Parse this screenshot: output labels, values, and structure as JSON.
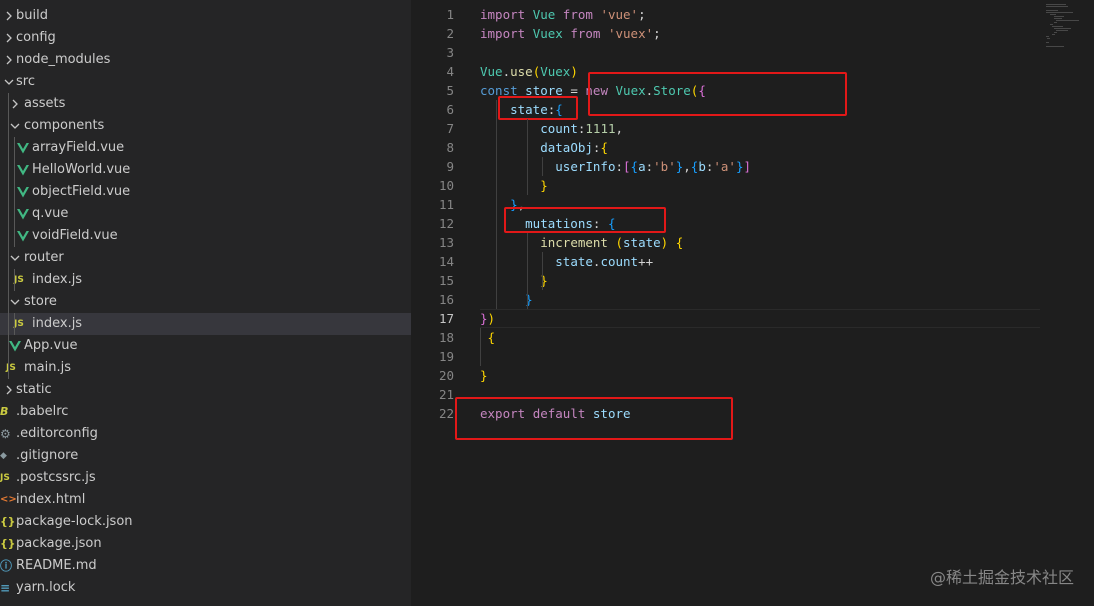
{
  "explorer": {
    "items": [
      {
        "label": "build",
        "type": "folder",
        "expanded": false
      },
      {
        "label": "config",
        "type": "folder",
        "expanded": false
      },
      {
        "label": "node_modules",
        "type": "folder",
        "expanded": false
      },
      {
        "label": "src",
        "type": "folder",
        "expanded": true
      },
      {
        "label": "assets",
        "type": "folder",
        "expanded": false
      },
      {
        "label": "components",
        "type": "folder",
        "expanded": true
      },
      {
        "label": "arrayField.vue",
        "type": "vue"
      },
      {
        "label": "HelloWorld.vue",
        "type": "vue"
      },
      {
        "label": "objectField.vue",
        "type": "vue"
      },
      {
        "label": "q.vue",
        "type": "vue"
      },
      {
        "label": "voidField.vue",
        "type": "vue"
      },
      {
        "label": "router",
        "type": "folder",
        "expanded": true
      },
      {
        "label": "index.js",
        "type": "js"
      },
      {
        "label": "store",
        "type": "folder",
        "expanded": true
      },
      {
        "label": "index.js",
        "type": "js",
        "selected": true
      },
      {
        "label": "App.vue",
        "type": "vue"
      },
      {
        "label": "main.js",
        "type": "js"
      },
      {
        "label": "static",
        "type": "folder",
        "expanded": false
      },
      {
        "label": ".babelrc",
        "type": "babel"
      },
      {
        "label": ".editorconfig",
        "type": "gear"
      },
      {
        "label": ".gitignore",
        "type": "git"
      },
      {
        "label": ".postcssrc.js",
        "type": "js"
      },
      {
        "label": "index.html",
        "type": "html"
      },
      {
        "label": "package-lock.json",
        "type": "json"
      },
      {
        "label": "package.json",
        "type": "json"
      },
      {
        "label": "README.md",
        "type": "info"
      },
      {
        "label": "yarn.lock",
        "type": "yarn"
      }
    ],
    "icon_glyphs": {
      "js": "JS",
      "json": "{ }"
    },
    "colors": {
      "vue": "#41b883",
      "js": "#cbcb41",
      "json": "#cbcb41",
      "html": "#e37933",
      "babel": "#cbcb41",
      "git": "#41535b",
      "gear": "#6d8086",
      "info": "#519aba",
      "yarn": "#519aba"
    }
  },
  "editor": {
    "active_line": 17,
    "lines": [
      "import Vue from 'vue';",
      "import Vuex from 'vuex';",
      "",
      "Vue.use(Vuex)",
      "const store = new Vuex.Store({",
      "    state:{",
      "        count:1111,",
      "        dataObj:{",
      "          userInfo:[{a:'b'},{b:'a'}]",
      "        }",
      "    },",
      "      mutations: {",
      "        increment (state) {",
      "          state.count++",
      "        }",
      "      }",
      "})",
      " {",
      "",
      "}",
      "",
      "export default store"
    ]
  },
  "watermark": "@稀土掘金技术社区",
  "annotation_color": "#e21818"
}
